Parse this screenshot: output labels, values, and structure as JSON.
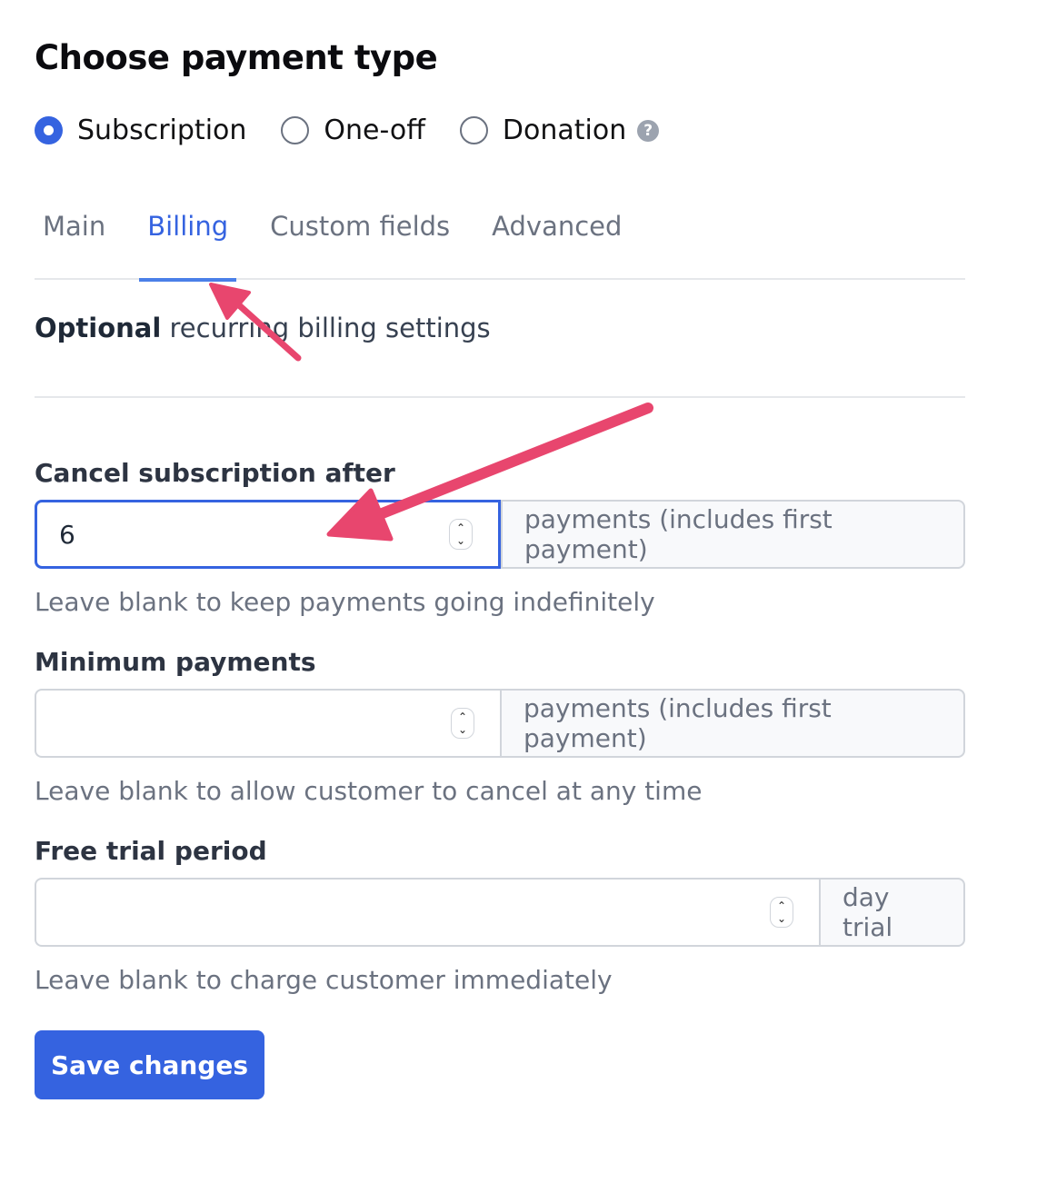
{
  "page": {
    "title": "Choose payment type"
  },
  "payment_types": {
    "options": [
      {
        "label": "Subscription",
        "selected": true
      },
      {
        "label": "One-off",
        "selected": false
      },
      {
        "label": "Donation",
        "selected": false
      }
    ],
    "help_icon": "question-circle-icon",
    "help_glyph": "?"
  },
  "tabs": [
    {
      "label": "Main",
      "active": false
    },
    {
      "label": "Billing",
      "active": true
    },
    {
      "label": "Custom fields",
      "active": false
    },
    {
      "label": "Advanced",
      "active": false
    }
  ],
  "billing": {
    "description_bold": "Optional",
    "description_rest": " recurring billing settings",
    "fields": [
      {
        "label": "Cancel subscription after",
        "value": "6",
        "addon": "payments (includes first payment)",
        "help": "Leave blank to keep payments going indefinitely",
        "focused": true
      },
      {
        "label": "Minimum payments",
        "value": "",
        "addon": "payments (includes first payment)",
        "help": "Leave blank to allow customer to cancel at any time",
        "focused": false
      },
      {
        "label": "Free trial period",
        "value": "",
        "addon": "day trial",
        "help": "Leave blank to charge customer immediately",
        "focused": false
      }
    ],
    "spinner_up": "⌃",
    "spinner_down": "⌄"
  },
  "actions": {
    "save_label": "Save changes"
  },
  "colors": {
    "accent": "#3563e0",
    "annotation_arrow": "#e8466e"
  }
}
